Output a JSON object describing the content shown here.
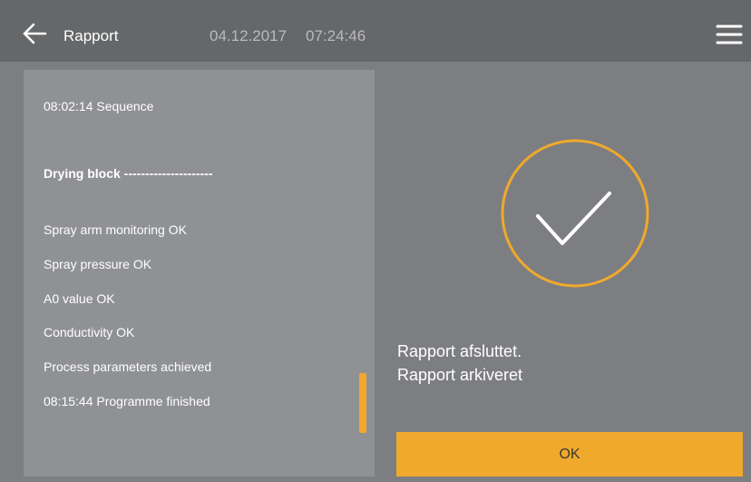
{
  "header": {
    "title": "Rapport",
    "date": "04.12.2017",
    "time": "07:24:46",
    "back_icon": "arrow-left-icon",
    "menu_icon": "hamburger-menu-icon"
  },
  "log": {
    "lines": [
      "08:02:14 Sequence",
      "Drying block ---------------------",
      "Spray arm monitoring OK",
      "Spray pressure OK",
      "A0 value OK",
      "Conductivity OK",
      "Process parameters achieved",
      "08:15:44 Programme finished"
    ],
    "scroll_position": 0.85
  },
  "status": {
    "icon": "checkmark-circle-icon",
    "line1": "Rapport afsluttet.",
    "line2": "Rapport arkiveret"
  },
  "actions": {
    "ok_label": "OK"
  },
  "colors": {
    "background": "#7d7e81",
    "header": "#666769",
    "panel": "#909194",
    "accent": "#f0a92c",
    "text": "#ffffff",
    "muted_text": "#b9babc"
  }
}
